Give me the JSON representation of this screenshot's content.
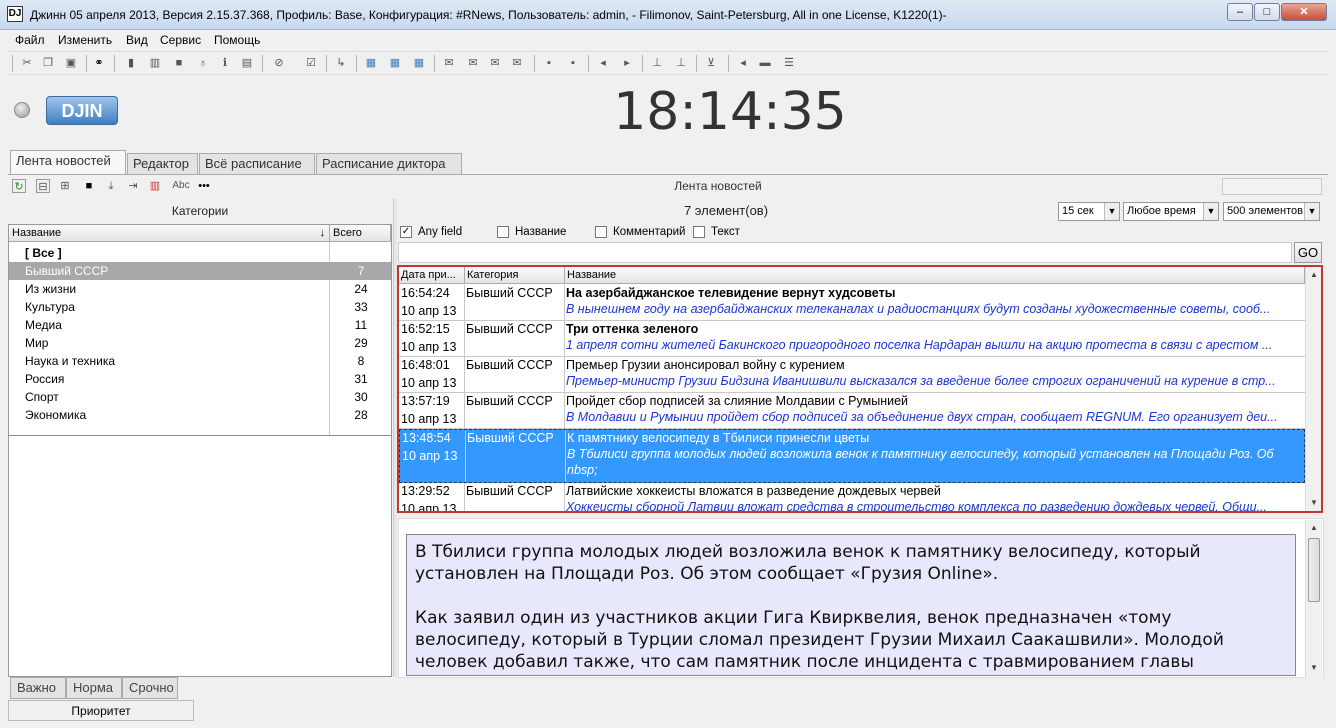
{
  "window": {
    "title": "Джинн 05 апреля 2013, Версия 2.15.37.368, Профиль: Base, Конфигурация: #RNews, Пользователь: admin, - Filimonov, Saint-Petersburg, All in one License, K1220(1)-",
    "app_icon": "DJ",
    "minimize": "‒",
    "maximize": "□",
    "close": "✕"
  },
  "menu": [
    "Файл",
    "Изменить",
    "Вид",
    "Сервис",
    "Помощь"
  ],
  "toolbar_icons": [
    "cut-icon",
    "copy-icon",
    "paste-icon",
    "binoculars-icon",
    "page-icon",
    "columns-icon",
    "square-icon",
    "mic-icon",
    "info-icon",
    "comment-icon",
    "forbid-icon",
    "check-icon",
    "arrow-icon",
    "grid-icon",
    "grid2-icon",
    "grid3-icon",
    "mail-icon",
    "mail2-icon",
    "mail3-icon",
    "mail4-icon",
    "save-icon",
    "lock-icon",
    "left-icon",
    "right-icon",
    "prev-icon",
    "next-icon",
    "down-icon",
    "sound-icon",
    "bar-icon",
    "list-icon"
  ],
  "logo": "DJIN",
  "clock": "18:14:35",
  "tabs": [
    "Лента новостей",
    "Редактор",
    "Всё расписание",
    "Расписание диктора"
  ],
  "subtoolbar": {
    "abc": "Abc",
    "more": "•••"
  },
  "feed_title": "Лента новостей",
  "categories": {
    "header": "Категории",
    "col_name": "Название",
    "col_total": "Всего",
    "sort_arrow": "↓",
    "rows": [
      {
        "name": "[ Все ]",
        "count": ""
      },
      {
        "name": "Бывший СССР",
        "count": "7"
      },
      {
        "name": "Из жизни",
        "count": "24"
      },
      {
        "name": "Культура",
        "count": "33"
      },
      {
        "name": "Медиа",
        "count": "11"
      },
      {
        "name": "Мир",
        "count": "29"
      },
      {
        "name": "Наука и техника",
        "count": "8"
      },
      {
        "name": "Россия",
        "count": "31"
      },
      {
        "name": "Спорт",
        "count": "30"
      },
      {
        "name": "Экономика",
        "count": "28"
      }
    ]
  },
  "priority": {
    "tabs": [
      "Важно",
      "Норма",
      "Срочно"
    ],
    "label": "Приоритет"
  },
  "news": {
    "count_label": "7 элемент(ов)",
    "refresh": "15 сек",
    "time_filter": "Любое время",
    "limit": "500 элементов",
    "checks": [
      {
        "label": "Any field",
        "checked": true,
        "mark": "✓"
      },
      {
        "label": "Название",
        "checked": false,
        "mark": ""
      },
      {
        "label": "Комментарий",
        "checked": false,
        "mark": ""
      },
      {
        "label": "Текст",
        "checked": false,
        "mark": ""
      }
    ],
    "go": "GO",
    "columns": [
      "Дата при...",
      "Категория",
      "Название"
    ],
    "rows": [
      {
        "time": "16:54:24",
        "date": "10 апр 13",
        "category": "Бывший СССР",
        "title": "На азербайджанское телевидение вернут худсоветы",
        "summary": "В нынешнем году на азербайджанских телеканалах и радиостанциях будут созданы художественные советы, сооб..."
      },
      {
        "time": "16:52:15",
        "date": "10 апр 13",
        "category": "Бывший СССР",
        "title": "Три оттенка зеленого",
        "summary": "1 апреля сотни жителей Бакинского пригородного поселка Нардаран вышли на акцию протеста в связи с арестом ..."
      },
      {
        "time": "16:48:01",
        "date": "10 апр 13",
        "category": "Бывший СССР",
        "title": "Премьер Грузии анонсировал войну с курением",
        "summary": "Премьер-министр Грузии Бидзина Иванишвили высказался за введение более строгих ограничений на курение в стр..."
      },
      {
        "time": "13:57:19",
        "date": "10 апр 13",
        "category": "Бывший СССР",
        "title": "Пройдет сбор подписей за слияние Молдавии с Румынией",
        "summary": "В Молдавии и Румынии пройдет сбор подписей за объединение двух стран, сообщает REGNUM. Его организует деи..."
      },
      {
        "time": "13:48:54",
        "date": "10 апр 13",
        "category": "Бывший СССР",
        "title": "К памятнику велосипеду в Тбилиси принесли цветы",
        "summary": "В Тбилиси группа молодых людей возложила венок к памятнику велосипеду, который установлен на Площади Роз. Об",
        "summary2": "nbsp;"
      },
      {
        "time": "13:29:52",
        "date": "10 апр 13",
        "category": "Бывший СССР",
        "title": "Латвийские хоккеисты вложатся в разведение дождевых червей",
        "summary": "Хоккеисты сборной Латвии вложат средства в строительство комплекса по разведению дождевых червей. Общи..."
      }
    ],
    "scroll_up": "▲",
    "scroll_down": "▼"
  },
  "preview": {
    "p1": "В Тбилиси группа молодых людей возложила венок к памятнику велосипеду, который установлен на Площади Роз. Об этом сообщает «Грузия Online».",
    "p2": "Как заявил один из участников акции Гига Квирквелия, венок предназначен «тому велосипеду, который в Турции сломал президент Грузии Михаил Саакашвили». Молодой человек добавил также, что сам памятник после инцидента с травмированием главы"
  }
}
